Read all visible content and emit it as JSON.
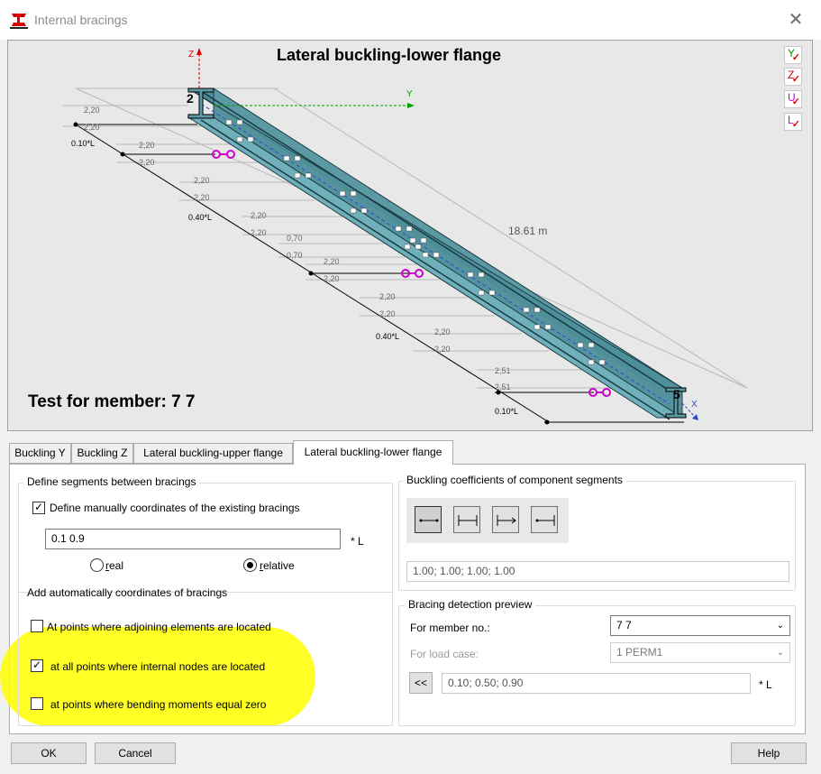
{
  "window": {
    "title": "Internal bracings",
    "close_label": "✕"
  },
  "preview": {
    "title": "Lateral buckling-lower flange",
    "member_caption": "Test for member: 7 7",
    "length_label": "18.61 m",
    "axis_labels": {
      "z": "Z",
      "y": "Y",
      "x": "X"
    },
    "node_labels": {
      "start": "2",
      "end": "5"
    },
    "view_buttons": [
      {
        "label": "Y",
        "color": "#009900",
        "icon": "check-icon"
      },
      {
        "label": "Z",
        "color": "#cc0000",
        "icon": "check-icon"
      },
      {
        "label": "U",
        "color": "#cc00cc",
        "icon": "check-icon"
      },
      {
        "label": "L",
        "color": "#cc00cc",
        "icon": "check-icon"
      }
    ],
    "left_dims": [
      "2,20",
      "2,20",
      "2,20",
      "2,20",
      "2,20",
      "2,20",
      "2,20",
      "2,20",
      "2,20",
      "0,70",
      "0,70",
      "2,20",
      "2,20",
      "2,20",
      "2,20",
      "2,20",
      "2,20",
      "2,51",
      "2,51"
    ],
    "fraction_labels": [
      "0.10*L",
      "0.40*L",
      "0.40*L",
      "0.10*L"
    ],
    "beam_color": "#4d8f9a",
    "bracing_color": "#cc00cc"
  },
  "tabs": [
    {
      "label": "Buckling Y",
      "active": false
    },
    {
      "label": "Buckling Z",
      "active": false
    },
    {
      "label": "Lateral buckling-upper flange",
      "active": false
    },
    {
      "label": "Lateral buckling-lower flange",
      "active": true
    }
  ],
  "define_segments": {
    "title": "Define segments between bracings",
    "manual_checkbox_label": "Define manually coordinates of the existing bracings",
    "manual_checked": true,
    "coordinates_value": "0.1 0.9",
    "unit": "* L",
    "radio_real_prefix": "",
    "radio_real_mnemonic": "r",
    "radio_real_rest": "eal",
    "radio_relative_prefix": "",
    "radio_relative_mnemonic": "r",
    "radio_relative_rest": "elative",
    "selected": "relative"
  },
  "auto_coords": {
    "title": "Add automatically coordinates of bracings",
    "options": [
      {
        "label": "At points where adjoining elements are located",
        "checked": false
      },
      {
        "label": "at all points where internal nodes are located",
        "checked": true
      },
      {
        "label": "at points where bending moments equal zero",
        "checked": false
      }
    ]
  },
  "buckling_coeffs": {
    "title": "Buckling coefficients of component segments",
    "value": "1.00; 1.00; 1.00; 1.00",
    "buttons": [
      "pinned-pinned-icon",
      "fixed-fixed-icon",
      "fixed-pinned-icon",
      "pinned-fixed-icon"
    ]
  },
  "detection_preview": {
    "title": "Bracing detection preview",
    "member_label": "For member no.:",
    "member_value": "7  7",
    "loadcase_label": "For load case:",
    "loadcase_value": "1  PERM1",
    "shift_label": "<<",
    "result_value": "0.10; 0.50; 0.90",
    "unit": "* L"
  },
  "footer": {
    "ok": "OK",
    "cancel": "Cancel",
    "help": "Help"
  }
}
